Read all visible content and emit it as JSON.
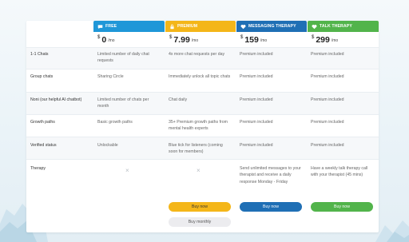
{
  "plans": [
    {
      "key": "free",
      "name": "FREE",
      "icon": "chat-bubble-icon",
      "color": "#1f97d8",
      "price": "0",
      "per": "/mo",
      "currency": "$"
    },
    {
      "key": "premium",
      "name": "PREMIUM",
      "icon": "lock-icon",
      "color": "#f4b619",
      "price": "7.99",
      "per": "/mo",
      "currency": "$"
    },
    {
      "key": "messaging",
      "name": "MESSAGING THERAPY",
      "icon": "heart-icon",
      "color": "#1f6fb5",
      "price": "159",
      "per": "/mo",
      "currency": "$"
    },
    {
      "key": "talk",
      "name": "TALK THERAPY",
      "icon": "heart-icon",
      "color": "#52b44b",
      "price": "299",
      "per": "/mo",
      "currency": "$"
    }
  ],
  "rows": [
    {
      "label": "1-1 Chats",
      "cells": [
        "Limited number of daily chat requests",
        "4x more chat requests per day",
        "Premium included",
        "Premium included"
      ]
    },
    {
      "label": "Group chats",
      "cells": [
        "Sharing Circle",
        "Immediately unlock all topic chats",
        "Premium included",
        "Premium included"
      ]
    },
    {
      "label": "Noni (our helpful AI chatbot)",
      "cells": [
        "Limited number of chats per month",
        "Chat daily",
        "Premium included",
        "Premium included"
      ]
    },
    {
      "label": "Growth paths",
      "cells": [
        "Basic growth paths",
        "35+ Premium growth paths from mental health experts",
        "Premium included",
        "Premium included"
      ]
    },
    {
      "label": "Verified status",
      "cells": [
        "Unlockable",
        "Blue tick for listeners (coming soon for members)",
        "Premium included",
        "Premium included"
      ]
    },
    {
      "label": "Therapy",
      "cells": [
        "×",
        "×",
        "Send unlimited messages to your therapist and receive a daily response Monday - Friday",
        "Have a weekly talk therapy call with your therapist (45 mins)"
      ]
    }
  ],
  "buttons": {
    "premium_buy": "Buy now",
    "premium_monthly": "Buy monthly",
    "messaging_buy": "Buy now",
    "talk_buy": "Buy now"
  }
}
